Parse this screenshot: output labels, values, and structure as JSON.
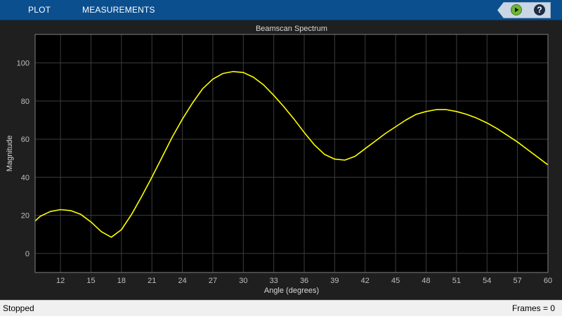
{
  "toolstrip": {
    "tabs": [
      {
        "label": "PLOT"
      },
      {
        "label": "MEASUREMENTS"
      }
    ],
    "icons": {
      "run": "run-icon",
      "help": "help-icon"
    },
    "help_glyph": "?"
  },
  "status": {
    "state": "Stopped",
    "frames": "Frames = 0"
  },
  "colors": {
    "toolstrip": "#0b4f8f",
    "plot_background": "#000000",
    "trace": "#ffff00",
    "axis_text": "#bfbfbf"
  },
  "chart_data": {
    "type": "line",
    "title": "Beamscan Spectrum",
    "xlabel": "Angle (degrees)",
    "ylabel": "Magnitude",
    "xlim": [
      9.5,
      60
    ],
    "ylim": [
      -10,
      115
    ],
    "xticks": [
      12,
      15,
      18,
      21,
      24,
      27,
      30,
      33,
      36,
      39,
      42,
      45,
      48,
      51,
      54,
      57,
      60
    ],
    "yticks": [
      0,
      20,
      40,
      60,
      80,
      100
    ],
    "grid": true,
    "series": [
      {
        "x": [
          9.5,
          10,
          11,
          12,
          13,
          14,
          15,
          16,
          17,
          18,
          19,
          20,
          21,
          22,
          23,
          24,
          25,
          26,
          27,
          28,
          29,
          30,
          31,
          32,
          33,
          34,
          35,
          36,
          37,
          38,
          39,
          40,
          41,
          42,
          43,
          44,
          45,
          46,
          47,
          48,
          49,
          50,
          51,
          52,
          53,
          54,
          55,
          56,
          57,
          58,
          59,
          60
        ],
        "y": [
          17,
          19.5,
          22,
          23,
          22.5,
          20.5,
          16.5,
          11.5,
          8.5,
          12.5,
          20.5,
          30,
          40,
          50.5,
          61,
          70.5,
          79,
          86.5,
          91.5,
          94.5,
          95.5,
          95,
          92.5,
          88.5,
          83,
          77,
          70.5,
          63.5,
          57,
          52,
          49.5,
          49,
          51,
          55,
          59,
          63,
          66.5,
          70,
          73,
          74.5,
          75.5,
          75.5,
          74.5,
          73,
          71,
          68.5,
          65.5,
          62,
          58.5,
          54.5,
          50.5,
          46.5
        ]
      }
    ]
  }
}
